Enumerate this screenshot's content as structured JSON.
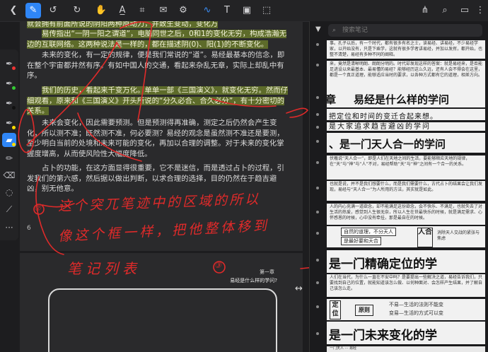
{
  "toolbar": {
    "icons": [
      "back-icon",
      "pen-icon",
      "undo-icon",
      "redo-icon",
      "hand-icon",
      "text-highlight-icon",
      "crop-icon",
      "envelope-icon",
      "settings-icon",
      "lasso-icon",
      "text-box-icon",
      "image-icon",
      "selection-icon",
      "share-icon",
      "search-icon",
      "bookmark-icon",
      "more-icon"
    ]
  },
  "sidebar": {
    "search_placeholder": "搜索笔记"
  },
  "document": {
    "para1": "就会拥有前面所说的阴阳两种原动力，并致生变动，变化万",
    "para2": "易传指出“一阴一阳之谓道”，电脑同世之后，0和1的变化无穷，构成浩瀚无边的互联网络。这两种说法是一样的，都在描述阴(0)、阳(1)的不断变化。",
    "para3": "未来的变化，有一定的规律，便是我们常说的“道”。易经最基本的信念，即在整个宇宙都井然有序。有如中国人的交通，看起来杂乱无章，实际上却乱中有序。",
    "para4": "我们的历史，看起来千变万化。单单一部《三国演义》，就变化无穷。然而仔细观看，原来和《三国演义》开头所说的“分久必合、合久必分”，有十分密切的关系。",
    "para5": "未来会变化，因此需要预测。但是预测得再准确，测定之后仍然会产生变化，所以测不准；既然测不准，何必要测？易经的观念是虽然测不准还是要测，至少明白当前的处境和未来可能的变化，再加以合理的调整。对于未来的变化掌握度增高，从而使风险性大幅度降低。",
    "para6": "占卜的功能，在这方面显得很重要，它不是迷信，而是透过占卜的过程，引发我们的第六感，然后据以做出判断，以求合理的选择，目的仍然在于趋吉避凶，别无他意。",
    "page_number": "6",
    "chapter_label": "第一章",
    "chapter_title": "易经是什么样的学问?"
  },
  "handwriting": {
    "circle_2": "②",
    "line1": "这个突兀笔迹中的区域的所以",
    "line2": "像这个框一样，把他整体移到",
    "line3": "笔记列表",
    "circle_3": "③"
  },
  "notes": {
    "card1_text": "事。孔子以后，有一个时代，都有很多有名之士，读易经、讲易经，不少易经学家，以开始没有，只是下乘学，这就有很多学者讲易经，并加以发挥，都开始，也整不清楚，易经有多种不同的阐释。",
    "card2_text": "来，竟然是清晰明朗、朗朗分明的。时代却发现这样的答案：就是易经来，是否能足进设以来最基本、最易懂的易经？能够经历这么久远，还有人会不得会在这里，都是一个真正道理，能够适应当时的要求，以各种方式都有它的道理，相差方向。",
    "card3_title": "易经是什么样的学问",
    "card3_prefix": "章",
    "card4_text": "把定位和时间的变迁合起来想。",
    "card5_text": "是大家追求趋吉避凶的学问",
    "card6_title": "、是一门天人合一的学问",
    "card7_text": "伏羲说“天人合一”，即是人们在天地之间的生活，要能够顺应天地的规律，在“天”与“神”与“人”不对，易经帮助“天”与“神”之间有一个合一的关系。",
    "card8_text": "也就是说，并不是我们想要什么，而是我们需要什么，古代占卜的结果会让我们发现，易经与“天人合一”为人所用的方法，其实就是如此。",
    "card9_text": "人的内心充满一道欲念，却不能满足这份欲念，会不快乐、不满足，也就失去了对生活的热爱，感觉到人生很无奈，所以人生在世最快乐的时候，就是满足需求、心怀感恩的时候，心中没有牵挂，那是最自在的时候。",
    "card10_chip1": "自然的道理，不分天人",
    "card10_chip2": "是最好要和天合",
    "card10_box": "人合",
    "card10_right": "消除天人交战的紧张与焦虑",
    "card11_title": "是一门精确定位的学",
    "card12_text": "人们在当代，为什么一直在不安中吗？是要提出一些解决之道，易经告诉我们，只要找到自己的位置，就能知道该怎么做、以何种面对、会怎样产生结果，并了解自己该怎么走。",
    "card13_box1": "定",
    "card13_box2": "位",
    "card13_mid": "原则",
    "card13_r1": "不易—生活的法则不能变",
    "card13_r2": "变易—生活的方式可以变",
    "card14_title": "是一门未来变化的学",
    "card15_text": "一门天人 ··· 易经"
  },
  "colors": {
    "accent": "#2f86f6",
    "highlight": "#5d6b2a",
    "ink": "#e02a2a"
  }
}
